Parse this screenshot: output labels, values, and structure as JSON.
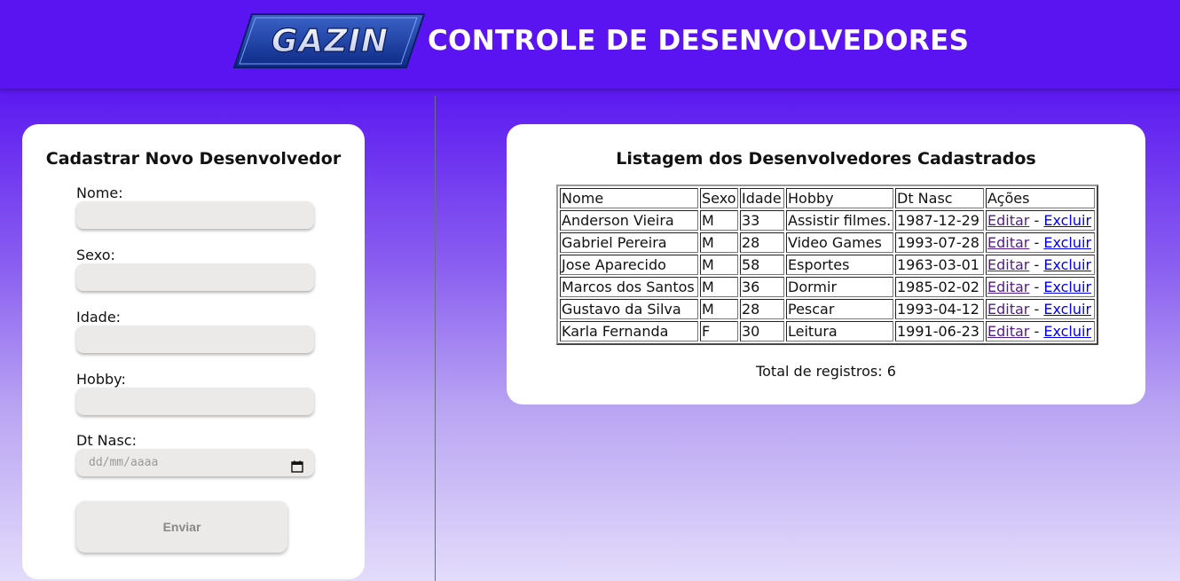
{
  "header": {
    "logo_text": "GAZIN",
    "title": "CONTROLE DE DESENVOLVEDORES"
  },
  "form": {
    "title": "Cadastrar Novo Desenvolvedor",
    "fields": [
      {
        "label": "Nome:",
        "value": ""
      },
      {
        "label": "Sexo:",
        "value": ""
      },
      {
        "label": "Idade:",
        "value": ""
      },
      {
        "label": "Hobby:",
        "value": ""
      },
      {
        "label": "Dt Nasc:",
        "placeholder": "dd/mm/aaaa"
      }
    ],
    "submit_label": "Enviar"
  },
  "list": {
    "title": "Listagem dos Desenvolvedores Cadastrados",
    "columns": [
      "Nome",
      "Sexo",
      "Idade",
      "Hobby",
      "Dt Nasc",
      "Ações"
    ],
    "rows": [
      {
        "nome": "Anderson Vieira",
        "sexo": "M",
        "idade": "33",
        "hobby": "Assistir filmes.",
        "dt_nasc": "1987-12-29"
      },
      {
        "nome": "Gabriel Pereira",
        "sexo": "M",
        "idade": "28",
        "hobby": "Video Games",
        "dt_nasc": "1993-07-28"
      },
      {
        "nome": "Jose Aparecido",
        "sexo": "M",
        "idade": "58",
        "hobby": "Esportes",
        "dt_nasc": "1963-03-01"
      },
      {
        "nome": "Marcos dos Santos",
        "sexo": "M",
        "idade": "36",
        "hobby": "Dormir",
        "dt_nasc": "1985-02-02"
      },
      {
        "nome": "Gustavo da Silva",
        "sexo": "M",
        "idade": "28",
        "hobby": "Pescar",
        "dt_nasc": "1993-04-12"
      },
      {
        "nome": "Karla Fernanda",
        "sexo": "F",
        "idade": "30",
        "hobby": "Leitura",
        "dt_nasc": "1991-06-23"
      }
    ],
    "action_edit": "Editar",
    "action_separator": " - ",
    "action_delete": "Excluir",
    "total_label": "Total de registros: 6"
  },
  "colors": {
    "header_bg": "#5a14f2",
    "input_bg": "#eceae8",
    "link_visited": "#551a8b",
    "link": "#0000ee"
  },
  "icons": {
    "date_picker": "calendar-icon"
  }
}
